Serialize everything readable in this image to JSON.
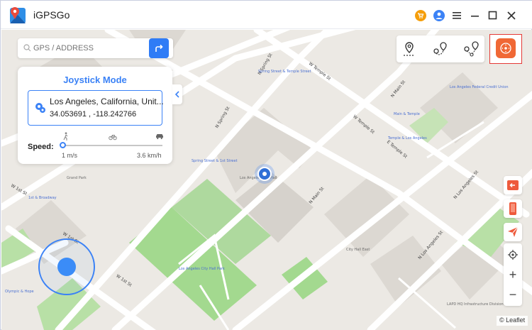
{
  "app": {
    "title": "iGPSGo"
  },
  "titlebar": {
    "icons": [
      "cart-icon",
      "user-icon",
      "menu-icon",
      "minimize-icon",
      "maximize-icon",
      "close-icon"
    ]
  },
  "search": {
    "placeholder": "GPS / ADDRESS"
  },
  "panel": {
    "title": "Joystick Mode",
    "location_name": "Los Angeles, California, Unit...",
    "coordinates": "34.053691 , -118.242766",
    "speed_label": "Speed:",
    "speed_min": "1 m/s",
    "speed_max": "3.6 km/h",
    "speed_level": 0,
    "modes": [
      "walk-icon",
      "bike-icon",
      "car-icon"
    ]
  },
  "route_modes": [
    "teleport-icon",
    "two-spot-route-icon",
    "multi-spot-route-icon",
    "joystick-mode-icon"
  ],
  "side_tools": [
    "exit-icon",
    "phone-icon",
    "send-icon",
    "locate-icon"
  ],
  "zoom": {
    "in": "+",
    "out": "−"
  },
  "attribution": "© Leaflet",
  "map": {
    "streets": [
      "N Spring St",
      "W Temple St",
      "N Main St",
      "N Spring St",
      "W Temple St",
      "E Temple St",
      "N Main St",
      "N Los Angeles St",
      "W 1st St",
      "W 1st St",
      "N Los Angeles St",
      "W 1st St"
    ],
    "pois": [
      "Los Angeles City Hall",
      "City Hall East",
      "Spring Street & Temple Street",
      "Spring Street & 1st Street",
      "Main & Temple",
      "Temple & Los Angeles",
      "Los Angeles Federal Credit Union",
      "Los Angeles City Hall Park",
      "Olympic & Hope",
      "LAPD HQ Infrastructure Division",
      "1st & Broadway",
      "Grand Park"
    ],
    "colors": {
      "land": "#ece9e4",
      "road": "#ffffff",
      "park": "#9fd58c",
      "building": "#dcd8d2"
    }
  }
}
